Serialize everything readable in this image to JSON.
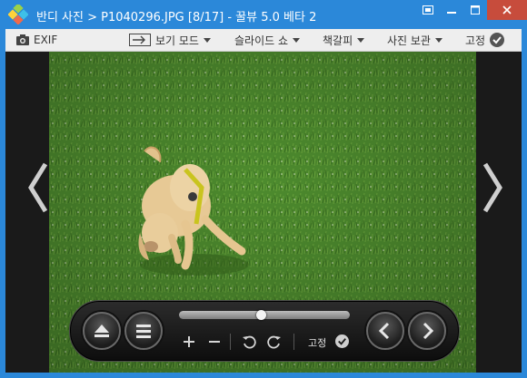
{
  "window": {
    "title": "반디 사진 > P1040296.JPG [8/17] - 꿀뷰 5.0 베타 2"
  },
  "toolbar": {
    "exif_label": "EXIF",
    "view_mode_label": "보기 모드",
    "slideshow_label": "슬라이드 쇼",
    "bookmark_label": "책갈피",
    "save_label": "사진 보관",
    "pin_label": "고정"
  },
  "controls": {
    "pin_label": "고정",
    "slider_position": 0.48
  },
  "colors": {
    "accent": "#2b88d9",
    "close": "#c74c3c",
    "grass": "#4c8a2c"
  }
}
